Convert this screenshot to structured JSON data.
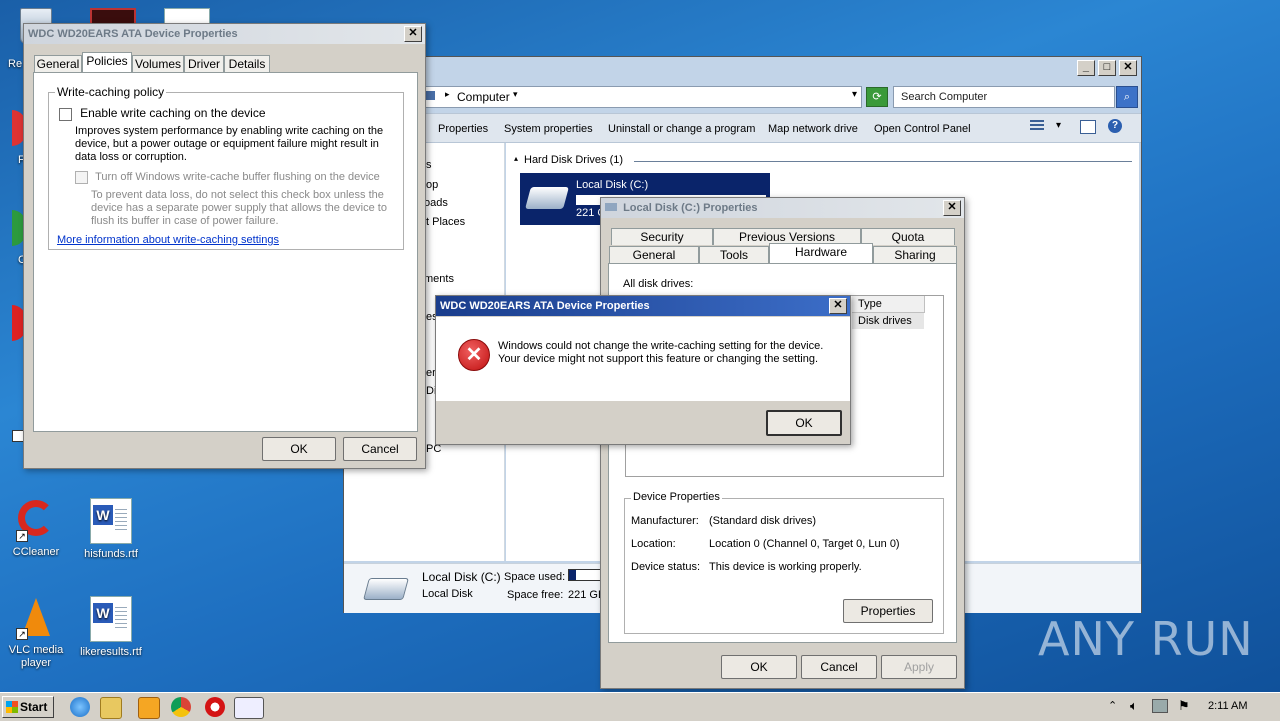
{
  "desktop": {
    "icons": [
      {
        "label": "CCleaner"
      },
      {
        "label": "hisfunds.rtf"
      },
      {
        "label": "VLC media player"
      },
      {
        "label": "likeresults.rtf"
      }
    ],
    "partial_labels": [
      "Re",
      "F",
      "C",
      "C"
    ]
  },
  "explorer": {
    "address": "Computer",
    "search_placeholder": "Search Computer",
    "toolbar": [
      "Properties",
      "System properties",
      "Uninstall or change a program",
      "Map network drive",
      "Open Control Panel"
    ],
    "nav_partial": [
      "s",
      "op",
      "oads",
      "t Places",
      "ments",
      "es",
      "er",
      "Dis",
      "PC"
    ],
    "section_title": "Hard Disk Drives (1)",
    "drive": {
      "name": "Local Disk (C:)",
      "size_partial": "221 G"
    },
    "details": {
      "name": "Local Disk (C:)",
      "type": "Local Disk",
      "space_used_label": "Space used:",
      "space_free_label": "Space free:",
      "space_free_value": "221 GB",
      "used_fraction": 0.2
    }
  },
  "policies_dialog": {
    "title": "WDC WD20EARS ATA Device Properties",
    "tabs": [
      "General",
      "Policies",
      "Volumes",
      "Driver",
      "Details"
    ],
    "selected_tab": "Policies",
    "group_title": "Write-caching policy",
    "enable_label": "Enable write caching on the device",
    "enable_desc": "Improves system performance by enabling write caching on the device, but a power outage or equipment failure might result in data loss or corruption.",
    "turnoff_label": "Turn off Windows write-cache buffer flushing on the device",
    "turnoff_desc": "To prevent data loss, do not select this check box unless the device has a separate power supply that allows the device to flush its buffer in case of power failure.",
    "link": "More information about write-caching settings",
    "ok": "OK",
    "cancel": "Cancel"
  },
  "disk_props": {
    "title": "Local Disk (C:) Properties",
    "tabs_row1": [
      "Security",
      "Previous Versions",
      "Quota"
    ],
    "tabs_row2": [
      "General",
      "Tools",
      "Hardware",
      "Sharing"
    ],
    "selected_tab": "Hardware",
    "all_drives_label": "All disk drives:",
    "col_type": "Type",
    "row_type": "Disk drives",
    "device_props_title": "Device Properties",
    "manufacturer_label": "Manufacturer:",
    "manufacturer": "(Standard disk drives)",
    "location_label": "Location:",
    "location": "Location 0 (Channel 0, Target 0, Lun 0)",
    "status_label": "Device status:",
    "status": "This device is working properly.",
    "properties_btn": "Properties",
    "ok": "OK",
    "cancel": "Cancel",
    "apply": "Apply"
  },
  "error_dialog": {
    "title": "WDC WD20EARS ATA Device Properties",
    "message": "Windows could not change the write-caching setting for the device. Your device might not support this feature or changing the setting.",
    "ok": "OK"
  },
  "taskbar": {
    "start": "Start",
    "clock": "2:11 AM"
  },
  "watermark": "ANY RUN"
}
